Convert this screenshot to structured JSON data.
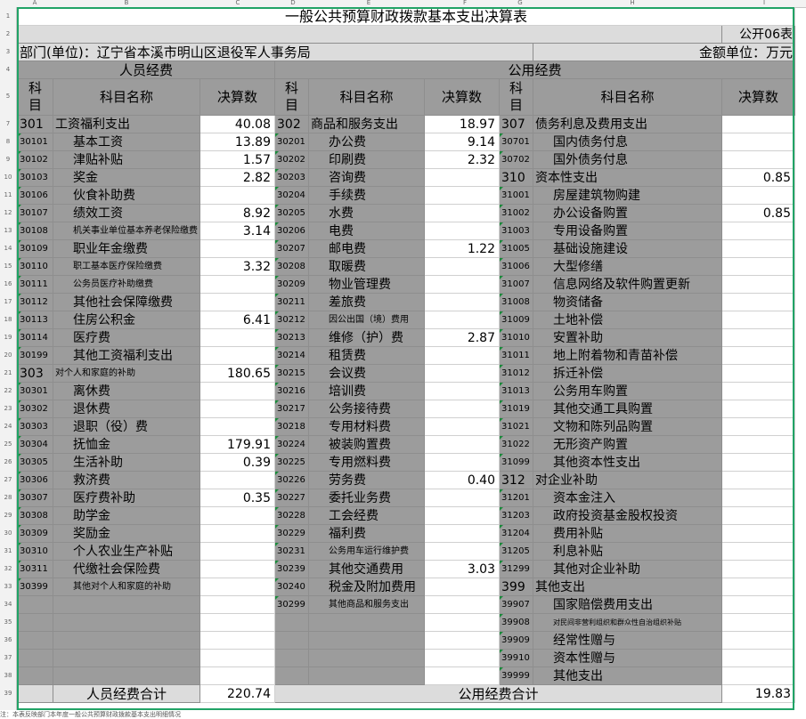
{
  "title": "一般公共预算财政拨款基本支出决算表",
  "form_no": "公开06表",
  "dept": "部门(单位)：辽宁省本溪市明山区退役军人事务局",
  "unit": "金额单位：万元",
  "col_letters": [
    "A",
    "B",
    "C",
    "D",
    "E",
    "F",
    "G",
    "H",
    "I"
  ],
  "sec_personnel": "人员经费",
  "sec_public": "公用经费",
  "hdr_code": "科\n目",
  "hdr_name": "科目名称",
  "hdr_amount": "决算数",
  "rows": [
    [
      "301",
      "工资福利支出",
      "40.08",
      "302",
      "商品和服务支出",
      "18.97",
      "307",
      "债务利息及费用支出",
      ""
    ],
    [
      "30101",
      "基本工资",
      "13.89",
      "30201",
      "办公费",
      "9.14",
      "30701",
      "国内债务付息",
      ""
    ],
    [
      "30102",
      "津贴补贴",
      "1.57",
      "30202",
      "印刷费",
      "2.32",
      "30702",
      "国外债务付息",
      ""
    ],
    [
      "30103",
      "奖金",
      "2.82",
      "30203",
      "咨询费",
      "",
      "310",
      "资本性支出",
      "0.85"
    ],
    [
      "30106",
      "伙食补助费",
      "",
      "30204",
      "手续费",
      "",
      "31001",
      "房屋建筑物购建",
      ""
    ],
    [
      "30107",
      "绩效工资",
      "8.92",
      "30205",
      "水费",
      "",
      "31002",
      "办公设备购置",
      "0.85"
    ],
    [
      "30108",
      "机关事业单位基本养老保险缴费",
      "3.14",
      "30206",
      "电费",
      "",
      "31003",
      "专用设备购置",
      ""
    ],
    [
      "30109",
      "职业年金缴费",
      "",
      "30207",
      "邮电费",
      "1.22",
      "31005",
      "基础设施建设",
      ""
    ],
    [
      "30110",
      "职工基本医疗保险缴费",
      "3.32",
      "30208",
      "取暖费",
      "",
      "31006",
      "大型修缮",
      ""
    ],
    [
      "30111",
      "公务员医疗补助缴费",
      "",
      "30209",
      "物业管理费",
      "",
      "31007",
      "信息网络及软件购置更新",
      ""
    ],
    [
      "30112",
      "其他社会保障缴费",
      "",
      "30211",
      "差旅费",
      "",
      "31008",
      "物资储备",
      ""
    ],
    [
      "30113",
      "住房公积金",
      "6.41",
      "30212",
      "因公出国（境）费用",
      "",
      "31009",
      "土地补偿",
      ""
    ],
    [
      "30114",
      "医疗费",
      "",
      "30213",
      "维修（护）费",
      "2.87",
      "31010",
      "安置补助",
      ""
    ],
    [
      "30199",
      "其他工资福利支出",
      "",
      "30214",
      "租赁费",
      "",
      "31011",
      "地上附着物和青苗补偿",
      ""
    ],
    [
      "303",
      "对个人和家庭的补助",
      "180.65",
      "30215",
      "会议费",
      "",
      "31012",
      "拆迁补偿",
      ""
    ],
    [
      "30301",
      "离休费",
      "",
      "30216",
      "培训费",
      "",
      "31013",
      "公务用车购置",
      ""
    ],
    [
      "30302",
      "退休费",
      "",
      "30217",
      "公务接待费",
      "",
      "31019",
      "其他交通工具购置",
      ""
    ],
    [
      "30303",
      "退职（役）费",
      "",
      "30218",
      "专用材料费",
      "",
      "31021",
      "文物和陈列品购置",
      ""
    ],
    [
      "30304",
      "抚恤金",
      "179.91",
      "30224",
      "被装购置费",
      "",
      "31022",
      "无形资产购置",
      ""
    ],
    [
      "30305",
      "生活补助",
      "0.39",
      "30225",
      "专用燃料费",
      "",
      "31099",
      "其他资本性支出",
      ""
    ],
    [
      "30306",
      "救济费",
      "",
      "30226",
      "劳务费",
      "0.40",
      "312",
      "对企业补助",
      ""
    ],
    [
      "30307",
      "医疗费补助",
      "0.35",
      "30227",
      "委托业务费",
      "",
      "31201",
      "资本金注入",
      ""
    ],
    [
      "30308",
      "助学金",
      "",
      "30228",
      "工会经费",
      "",
      "31203",
      "政府投资基金股权投资",
      ""
    ],
    [
      "30309",
      "奖励金",
      "",
      "30229",
      "福利费",
      "",
      "31204",
      "费用补贴",
      ""
    ],
    [
      "30310",
      "个人农业生产补贴",
      "",
      "30231",
      "公务用车运行维护费",
      "",
      "31205",
      "利息补贴",
      ""
    ],
    [
      "30311",
      "代缴社会保险费",
      "",
      "30239",
      "其他交通费用",
      "3.03",
      "31299",
      "其他对企业补助",
      ""
    ],
    [
      "30399",
      "其他对个人和家庭的补助",
      "",
      "30240",
      "税金及附加费用",
      "",
      "399",
      "其他支出",
      ""
    ],
    [
      "",
      "",
      "",
      "30299",
      "其他商品和服务支出",
      "",
      "39907",
      "国家赔偿费用支出",
      ""
    ],
    [
      "",
      "",
      "",
      "",
      "",
      "",
      "39908",
      "对民间非营利组织和群众性自治组织补贴",
      ""
    ],
    [
      "",
      "",
      "",
      "",
      "",
      "",
      "39909",
      "经常性赠与",
      ""
    ],
    [
      "",
      "",
      "",
      "",
      "",
      "",
      "39910",
      "资本性赠与",
      ""
    ],
    [
      "",
      "",
      "",
      "",
      "",
      "",
      "39999",
      "其他支出",
      ""
    ]
  ],
  "total_personnel_label": "人员经费合计",
  "total_personnel": "220.74",
  "total_public_label": "公用经费合计",
  "total_public": "19.83",
  "footer_note": "注：本表反映部门本年度一般公共预算财政拨款基本支出明细情况"
}
